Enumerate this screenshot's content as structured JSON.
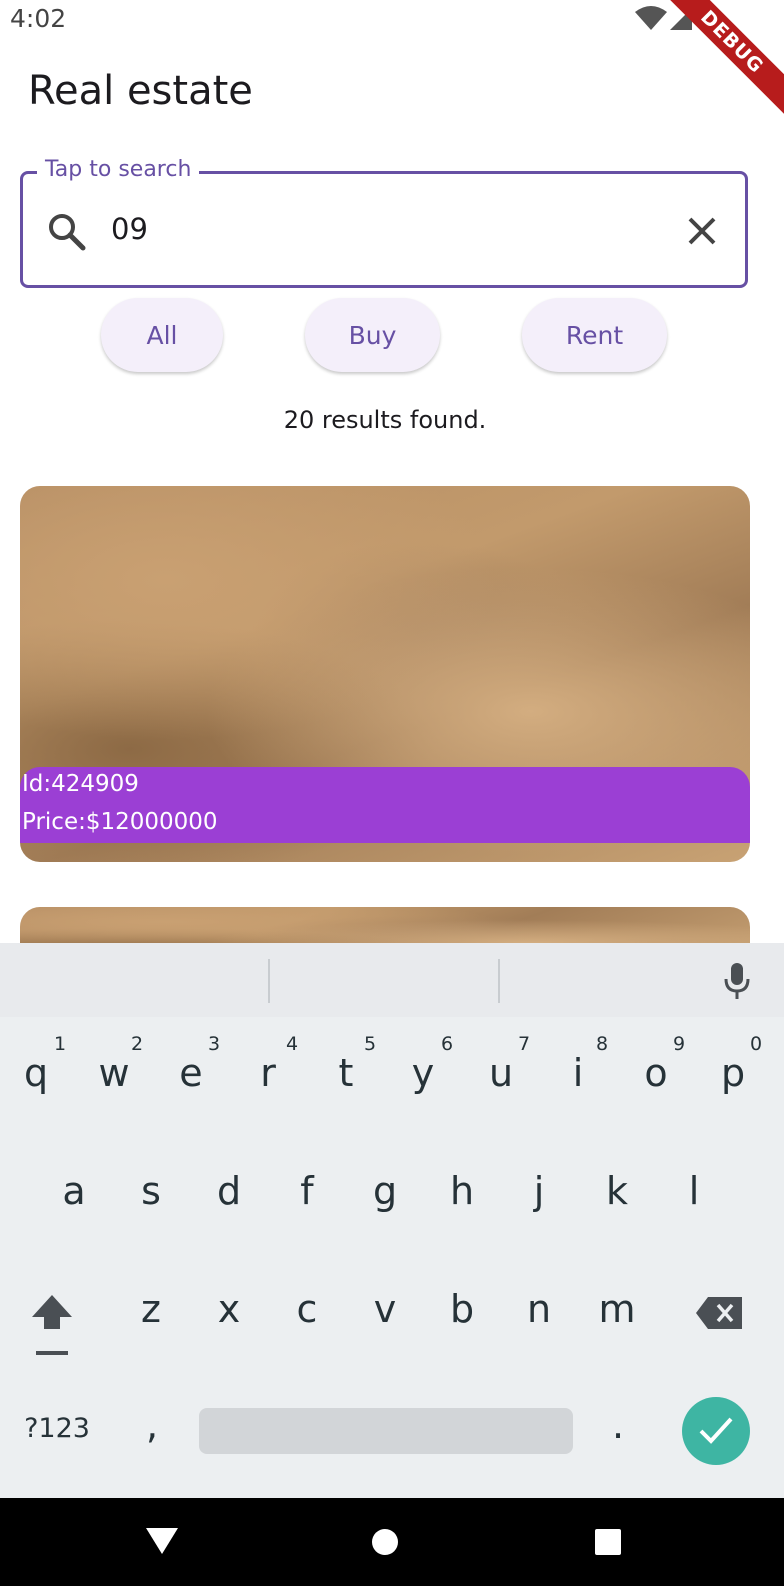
{
  "status_bar": {
    "time": "4:02",
    "debug_label": "DEBUG"
  },
  "app_bar": {
    "title": "Real estate"
  },
  "search": {
    "label": "Tap to search",
    "value": "09"
  },
  "filters": [
    {
      "label": "All"
    },
    {
      "label": "Buy"
    },
    {
      "label": "Rent"
    }
  ],
  "results": {
    "text": "20 results found."
  },
  "listings": [
    {
      "id": "Id:424909",
      "price": "Price:$12000000"
    }
  ],
  "keyboard": {
    "row1": [
      "q",
      "w",
      "e",
      "r",
      "t",
      "y",
      "u",
      "i",
      "o",
      "p"
    ],
    "row1_hints": [
      "1",
      "2",
      "3",
      "4",
      "5",
      "6",
      "7",
      "8",
      "9",
      "0"
    ],
    "row2": [
      "a",
      "s",
      "d",
      "f",
      "g",
      "h",
      "j",
      "k",
      "l"
    ],
    "row3": [
      "z",
      "x",
      "c",
      "v",
      "b",
      "n",
      "m"
    ],
    "symbols_label": "?123",
    "comma": ",",
    "period": "."
  },
  "colors": {
    "accent": "#6750a4",
    "card_label": "#9b3fd4",
    "enter": "#3eb5a3"
  }
}
